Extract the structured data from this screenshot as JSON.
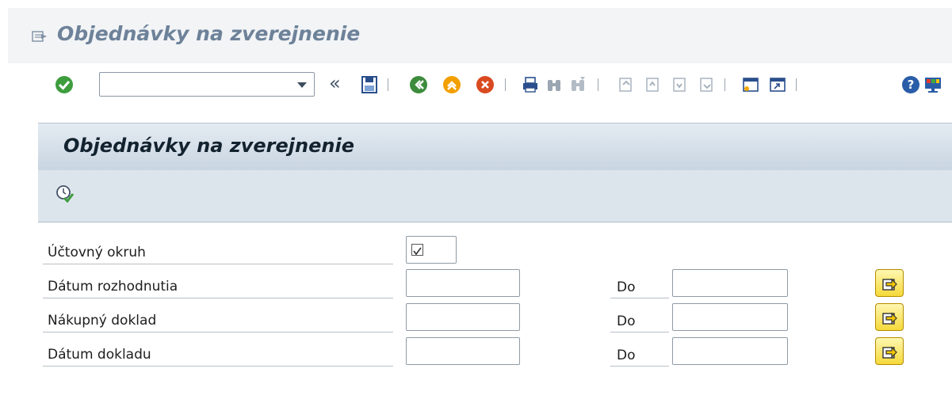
{
  "window": {
    "title": "Objednávky na zverejnenie"
  },
  "toolbar": {
    "command_field_value": "",
    "chevron": "«",
    "icons": [
      "enter-icon",
      "save-icon",
      "back-icon",
      "exit-icon",
      "cancel-icon",
      "print-icon",
      "find-icon",
      "find-next-icon",
      "first-page-icon",
      "previous-page-icon",
      "next-page-icon",
      "last-page-icon",
      "create-session-icon",
      "shortcut-icon",
      "help-icon",
      "customize-layout-icon"
    ]
  },
  "panel": {
    "title": "Objednávky na zverejnenie",
    "execute_icon": "execute-clock-icon"
  },
  "form": {
    "rows": [
      {
        "label": "Účtovný okruh",
        "type": "checkbox",
        "checked": false,
        "value": ""
      },
      {
        "label": "Dátum rozhodnutia",
        "from": "",
        "to_label": "Do",
        "to": ""
      },
      {
        "label": "Nákupný doklad",
        "from": "",
        "to_label": "Do",
        "to": ""
      },
      {
        "label": "Dátum dokladu",
        "from": "",
        "to_label": "Do",
        "to": ""
      }
    ]
  },
  "colors": {
    "title": "#6d8299",
    "panel_header": "#c9d5e1",
    "panel_toolbar": "#dde5ec",
    "multi_button": "#f5d93a"
  }
}
